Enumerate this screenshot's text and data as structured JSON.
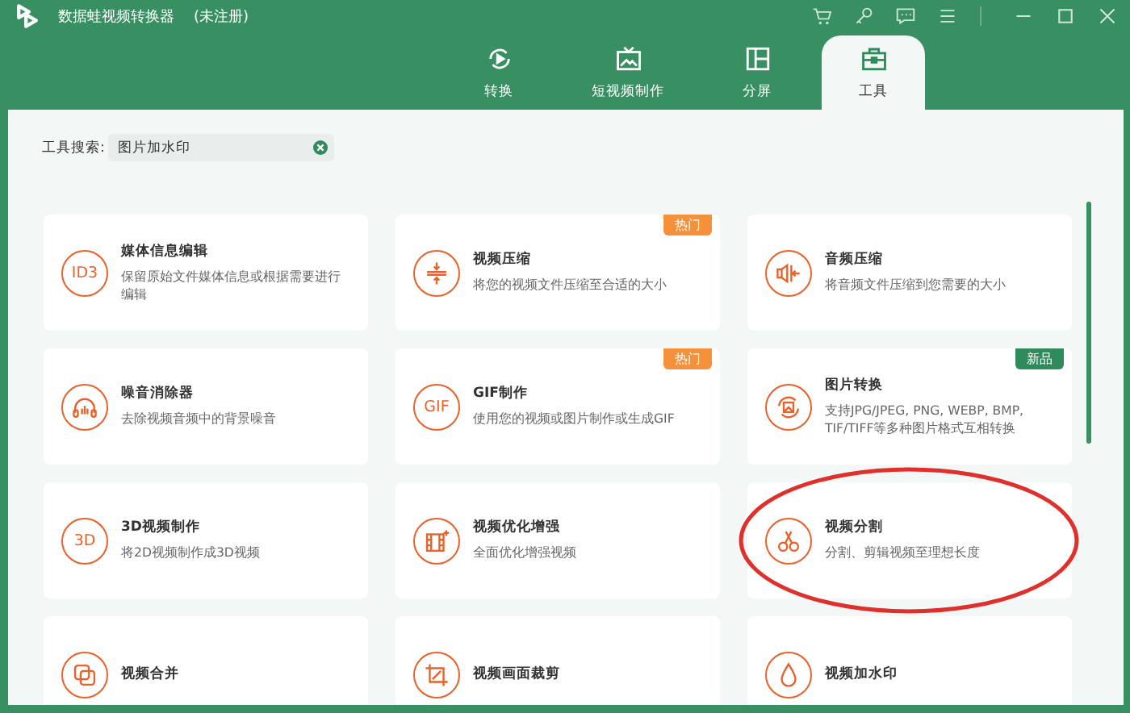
{
  "window": {
    "title": "数据蛙视频转换器",
    "status": "(未注册)"
  },
  "tabs": [
    {
      "label": "转换",
      "kind": "convert",
      "selected": false
    },
    {
      "label": "短视频制作",
      "kind": "tv",
      "selected": false
    },
    {
      "label": "分屏",
      "kind": "split",
      "selected": false
    },
    {
      "label": "工具",
      "kind": "toolbox",
      "selected": true
    }
  ],
  "search": {
    "label": "工具搜索:",
    "value": "图片加水印"
  },
  "tools": [
    {
      "title": "媒体信息编辑",
      "desc": "保留原始文件媒体信息或根据需要进行编辑",
      "kind": "text",
      "icon_text": "ID3",
      "circled": false
    },
    {
      "title": "视频压缩",
      "desc": "将您的视频文件压缩至合适的大小",
      "kind": "compress",
      "badge": {
        "text": "热门",
        "kind": "hot"
      },
      "circled": false
    },
    {
      "title": "音频压缩",
      "desc": "将音频文件压缩到您需要的大小",
      "kind": "audio",
      "circled": false
    },
    {
      "title": "噪音消除器",
      "desc": "去除视频音频中的背景噪音",
      "kind": "headphones",
      "circled": false
    },
    {
      "title": "GIF制作",
      "desc": "使用您的视频或图片制作或生成GIF",
      "kind": "text",
      "icon_text": "GIF",
      "badge": {
        "text": "热门",
        "kind": "hot"
      },
      "circled": false
    },
    {
      "title": "图片转换",
      "desc": "支持JPG/JPEG, PNG, WEBP, BMP, TIF/TIFF等多种图片格式互相转换",
      "kind": "image",
      "badge": {
        "text": "新品",
        "kind": "new"
      },
      "circled": false
    },
    {
      "title": "3D视频制作",
      "desc": "将2D视频制作成3D视频",
      "kind": "text",
      "icon_text": "3D",
      "circled": false
    },
    {
      "title": "视频优化增强",
      "desc": "全面优化增强视频",
      "kind": "enhance",
      "circled": false
    },
    {
      "title": "视频分割",
      "desc": "分割、剪辑视频至理想长度",
      "kind": "scissors",
      "circled": true
    },
    {
      "title": "视频合并",
      "kind": "merge",
      "circled": false
    },
    {
      "title": "视频画面裁剪",
      "kind": "crop",
      "circled": false
    },
    {
      "title": "视频加水印",
      "kind": "drop",
      "circled": false
    }
  ]
}
